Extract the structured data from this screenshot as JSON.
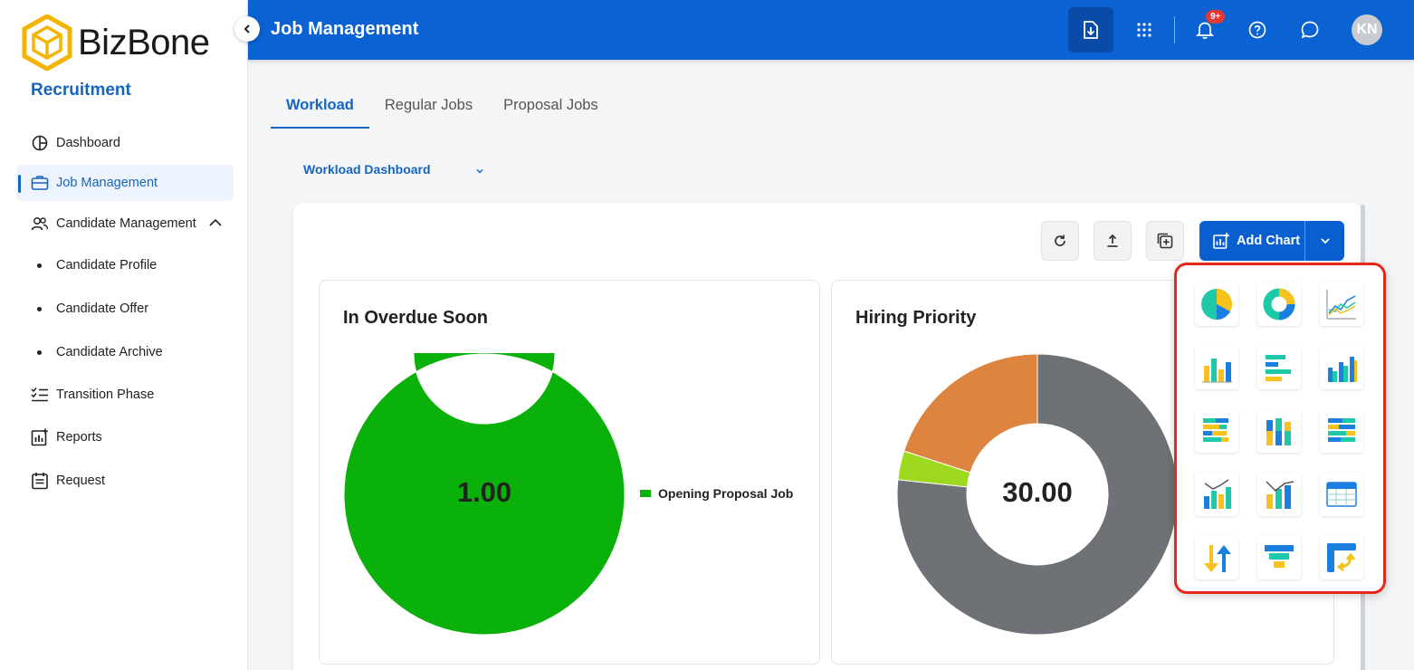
{
  "app": {
    "brand": "BizBone",
    "module": "Recruitment"
  },
  "sidebar": {
    "items": [
      {
        "label": "Dashboard",
        "icon": "pie-chart-icon"
      },
      {
        "label": "Job Management",
        "icon": "briefcase-icon",
        "active": true
      },
      {
        "label": "Candidate Management",
        "icon": "users-icon",
        "expanded": true
      },
      {
        "label": "Candidate Profile"
      },
      {
        "label": "Candidate Offer"
      },
      {
        "label": "Candidate Archive"
      },
      {
        "label": "Transition Phase",
        "icon": "checklist-icon"
      },
      {
        "label": "Reports",
        "icon": "report-chart-icon"
      },
      {
        "label": "Request",
        "icon": "request-form-icon"
      }
    ]
  },
  "header": {
    "title": "Job Management",
    "notification_badge": "9+",
    "avatar_initials": "KN"
  },
  "tabs": [
    {
      "label": "Workload",
      "active": true
    },
    {
      "label": "Regular Jobs"
    },
    {
      "label": "Proposal Jobs"
    }
  ],
  "dashboard_select": {
    "value": "Workload Dashboard"
  },
  "toolbar": {
    "add_chart_label": "Add Chart"
  },
  "cards": [
    {
      "title": "In Overdue Soon",
      "center_value": "1.00",
      "legend": [
        "Opening Proposal Job"
      ]
    },
    {
      "title": "Hiring Priority",
      "center_value": "30.00"
    }
  ],
  "chart_data": [
    {
      "type": "pie",
      "title": "In Overdue Soon",
      "categories": [
        "Opening Proposal Job"
      ],
      "values": [
        1
      ],
      "colors": [
        "#0ab10a"
      ]
    },
    {
      "type": "pie",
      "title": "Hiring Priority",
      "categories": [
        "",
        "",
        ""
      ],
      "values": [
        23,
        1,
        6
      ],
      "colors": [
        "#6e7175",
        "#9fd91f",
        "#dd8440"
      ]
    }
  ],
  "chart_type_options": [
    "pie-chart-option-icon",
    "donut-chart-option-icon",
    "line-chart-option-icon",
    "column-chart-option-icon",
    "bar-chart-option-icon",
    "clustered-column-option-icon",
    "stacked-bar-option-icon",
    "stacked-column-option-icon",
    "percent-bar-option-icon",
    "column-line-combo-option-icon",
    "stacked-line-combo-option-icon",
    "table-option-icon",
    "kpi-arrows-option-icon",
    "funnel-option-icon",
    "pivot-option-icon"
  ],
  "colors": {
    "accent": "#0a62d3",
    "highlight_border": "#e8271b"
  }
}
